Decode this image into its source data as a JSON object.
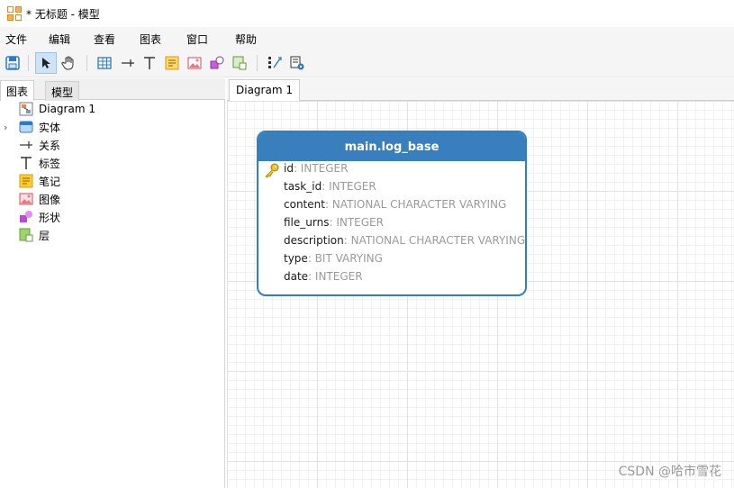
{
  "window": {
    "title": "* 无标题 - 模型"
  },
  "menu": [
    "文件",
    "编辑",
    "查看",
    "图表",
    "窗口",
    "帮助"
  ],
  "toolbar": {
    "icons": [
      "save-icon",
      "pointer-icon",
      "hand-icon",
      "table-icon",
      "relation-icon",
      "label-icon",
      "note-icon",
      "image-icon",
      "shape-icon",
      "layer-icon",
      "auto-layout-icon",
      "settings-icon"
    ]
  },
  "left_panel": {
    "tabs": [
      "图表",
      "模型"
    ],
    "items": [
      {
        "label": "Diagram 1",
        "icon": "diagram-icon"
      },
      {
        "label": "实体",
        "icon": "entity-icon",
        "expandable": true
      },
      {
        "label": "关系",
        "icon": "relation-icon"
      },
      {
        "label": "标签",
        "icon": "label-icon"
      },
      {
        "label": "笔记",
        "icon": "note-icon"
      },
      {
        "label": "图像",
        "icon": "image-icon"
      },
      {
        "label": "形状",
        "icon": "shape-icon"
      },
      {
        "label": "层",
        "icon": "layer-icon"
      }
    ]
  },
  "diagram": {
    "tab": "Diagram 1",
    "entity": {
      "name": "main.log_base",
      "fields": [
        {
          "name": "id",
          "type": ": INTEGER",
          "primary_key": true
        },
        {
          "name": "task_id",
          "type": ": INTEGER"
        },
        {
          "name": "content",
          "type": ": NATIONAL CHARACTER VARYING"
        },
        {
          "name": "file_urns",
          "type": ": INTEGER"
        },
        {
          "name": "description",
          "type": ": NATIONAL CHARACTER VARYING"
        },
        {
          "name": "type",
          "type": ": BIT VARYING"
        },
        {
          "name": "date",
          "type": ": INTEGER"
        }
      ]
    }
  },
  "watermark": "CSDN @哈市雪花",
  "colors": {
    "entity_header": "#3a7fbd",
    "entity_border": "#2f7fc1",
    "type_text": "#9a9a9a"
  }
}
